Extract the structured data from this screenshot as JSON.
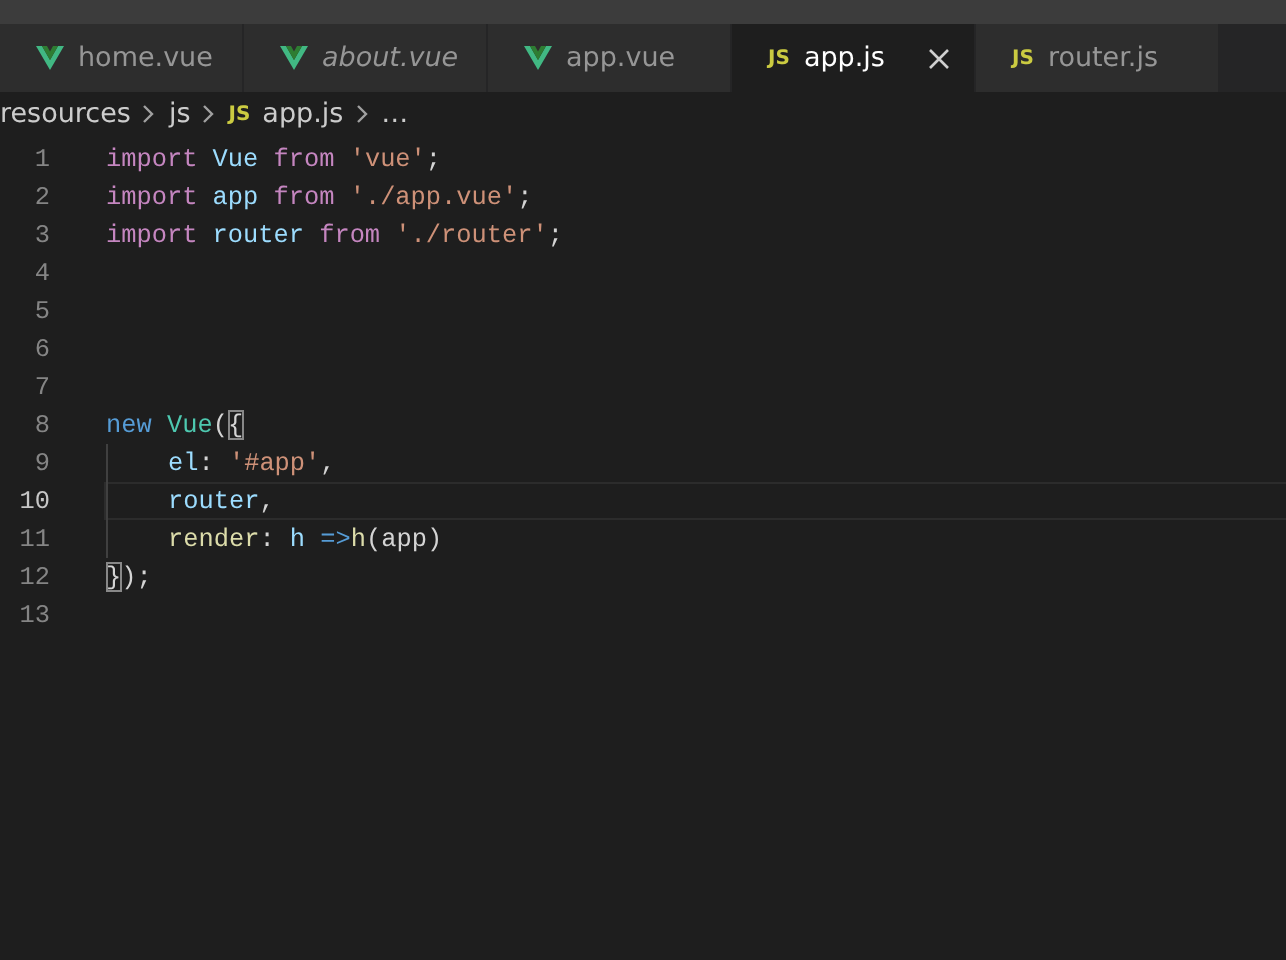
{
  "tabs": [
    {
      "label": "home.vue",
      "kind": "vue",
      "selected": false,
      "preview": false
    },
    {
      "label": "about.vue",
      "kind": "vue",
      "selected": false,
      "preview": true
    },
    {
      "label": "app.vue",
      "kind": "vue",
      "selected": false,
      "preview": false
    },
    {
      "label": "app.js",
      "kind": "js",
      "icon_text": "JS",
      "selected": true,
      "preview": false
    },
    {
      "label": "router.js",
      "kind": "js",
      "icon_text": "JS",
      "selected": false,
      "preview": false
    }
  ],
  "breadcrumb": [
    {
      "label": "resources",
      "kind": "folder"
    },
    {
      "label": "js",
      "kind": "folder"
    },
    {
      "label": "app.js",
      "kind": "js",
      "icon_text": "JS"
    },
    {
      "label": "…",
      "kind": "folder"
    }
  ],
  "editor": {
    "lines": [
      {
        "number": "1",
        "current": false,
        "indented": false,
        "tokens": [
          {
            "text": "import ",
            "kind": "keyword"
          },
          {
            "text": "Vue ",
            "kind": "variable"
          },
          {
            "text": "from ",
            "kind": "keyword"
          },
          {
            "text": "'vue'",
            "kind": "string"
          },
          {
            "text": ";",
            "kind": "plain"
          }
        ]
      },
      {
        "number": "2",
        "current": false,
        "indented": false,
        "tokens": [
          {
            "text": "import ",
            "kind": "keyword"
          },
          {
            "text": "app ",
            "kind": "variable"
          },
          {
            "text": "from ",
            "kind": "keyword"
          },
          {
            "text": "'./app.vue'",
            "kind": "string"
          },
          {
            "text": ";",
            "kind": "plain"
          }
        ]
      },
      {
        "number": "3",
        "current": false,
        "indented": false,
        "tokens": [
          {
            "text": "import ",
            "kind": "keyword"
          },
          {
            "text": "router ",
            "kind": "variable"
          },
          {
            "text": "from ",
            "kind": "keyword"
          },
          {
            "text": "'./router'",
            "kind": "string"
          },
          {
            "text": ";",
            "kind": "plain"
          }
        ]
      },
      {
        "number": "4",
        "current": false,
        "indented": false
      },
      {
        "number": "5",
        "current": false,
        "indented": false
      },
      {
        "number": "6",
        "current": false,
        "indented": false
      },
      {
        "number": "7",
        "current": false,
        "indented": false
      },
      {
        "number": "8",
        "current": false,
        "indented": false,
        "tokens": [
          {
            "text": "new ",
            "kind": "storage"
          },
          {
            "text": "Vue",
            "kind": "class"
          },
          {
            "text": "(",
            "kind": "plain"
          },
          {
            "text": "{",
            "kind": "bracket-match"
          }
        ]
      },
      {
        "number": "9",
        "current": false,
        "indented": true,
        "tokens": [
          {
            "text": "el",
            "kind": "variable"
          },
          {
            "text": ": ",
            "kind": "plain"
          },
          {
            "text": "'#app'",
            "kind": "string"
          },
          {
            "text": ",",
            "kind": "plain"
          }
        ]
      },
      {
        "number": "10",
        "current": true,
        "indented": true,
        "tokens": [
          {
            "text": "router",
            "kind": "variable"
          },
          {
            "text": ",",
            "kind": "plain"
          }
        ]
      },
      {
        "number": "11",
        "current": false,
        "indented": true,
        "tokens": [
          {
            "text": "render",
            "kind": "function"
          },
          {
            "text": ": ",
            "kind": "plain"
          },
          {
            "text": "h ",
            "kind": "variable"
          },
          {
            "text": "=>",
            "kind": "storage"
          },
          {
            "text": "h",
            "kind": "function"
          },
          {
            "text": "(app)",
            "kind": "plain"
          }
        ]
      },
      {
        "number": "12",
        "current": false,
        "indented": false,
        "tokens": [
          {
            "text": "}",
            "kind": "bracket-match"
          },
          {
            "text": ");",
            "kind": "plain"
          }
        ]
      },
      {
        "number": "13",
        "current": false,
        "indented": false
      }
    ]
  }
}
